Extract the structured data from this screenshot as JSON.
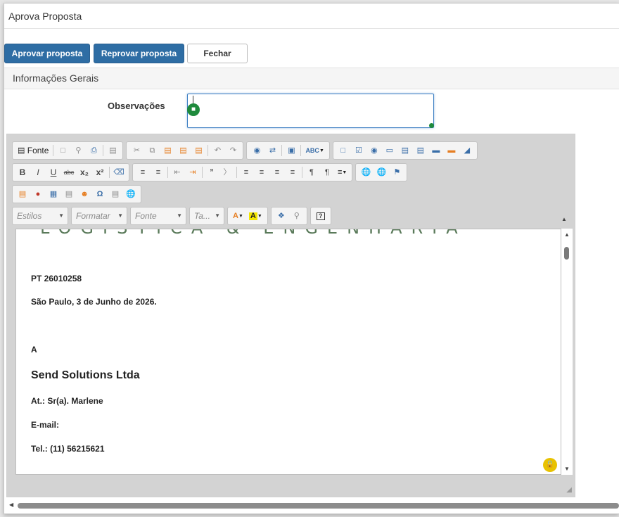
{
  "dialog": {
    "title": "Aprova Proposta",
    "buttons": {
      "approve": "Aprovar proposta",
      "reject": "Reprovar proposta",
      "close": "Fechar"
    },
    "section_title": "Informações Gerais",
    "observacoes_label": "Observações",
    "observacoes_value": ""
  },
  "editor": {
    "toolbar": {
      "source_label": "Fonte",
      "combos": [
        "Estilos",
        "Formatar",
        "Fonte",
        "Ta..."
      ],
      "bold": "B",
      "italic": "I",
      "underline": "U",
      "strike": "abc",
      "subscript": "x₂",
      "superscript": "x²",
      "spellcheck": "ABC"
    },
    "document": {
      "logo_text": "LOGÍSTICA & ENGENHARIA",
      "ref": "PT 26010258",
      "date_line": "São Paulo, 3 de Junho de 2026.",
      "to_label": "A",
      "company": "Send Solutions Ltda",
      "attn": "At.: Sr(a). Marlene",
      "email": "E-mail:",
      "tel": "Tel.:  (11) 56215621"
    }
  },
  "colors": {
    "primary": "#2e6da4",
    "bot_green": "#1e8a3c",
    "lock_yellow": "#e8c200"
  }
}
